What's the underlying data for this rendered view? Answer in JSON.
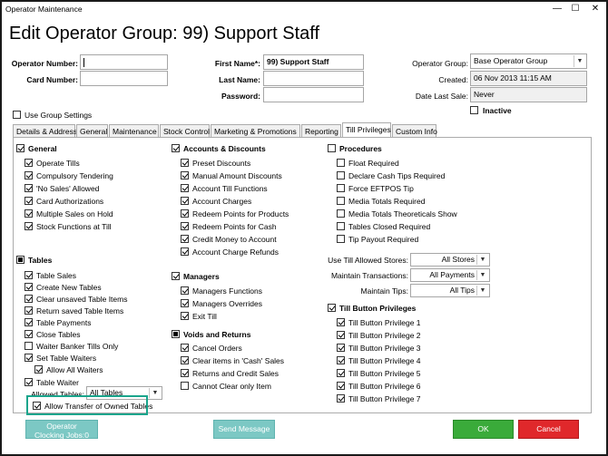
{
  "window": {
    "title": "Operator Maintenance",
    "minimize": "—",
    "maximize": "☐",
    "close": "✕"
  },
  "heading": "Edit Operator Group: 99) Support Staff",
  "form": {
    "operator_number_label": "Operator Number:",
    "operator_number_value": "",
    "card_number_label": "Card Number:",
    "card_number_value": "",
    "first_name_label": "First Name*:",
    "first_name_value": "99) Support Staff",
    "last_name_label": "Last Name:",
    "last_name_value": "",
    "password_label": "Password:",
    "password_value": "",
    "operator_group_label": "Operator Group:",
    "operator_group_value": "Base Operator Group",
    "created_label": "Created:",
    "created_value": "06 Nov 2013 11:15 AM",
    "date_last_sale_label": "Date Last Sale:",
    "date_last_sale_value": "Never",
    "inactive_label": "Inactive",
    "use_group_settings_label": "Use Group Settings"
  },
  "tabs": [
    {
      "label": "Details & Address"
    },
    {
      "label": "General"
    },
    {
      "label": "Maintenance"
    },
    {
      "label": "Stock Control"
    },
    {
      "label": "Marketing & Promotions"
    },
    {
      "label": "Reporting"
    },
    {
      "label": "Till Privileges"
    },
    {
      "label": "Custom Info"
    }
  ],
  "general": {
    "header": "General",
    "items": [
      "Operate Tills",
      "Compulsory Tendering",
      "'No Sales' Allowed",
      "Card Authorizations",
      "Multiple Sales on Hold",
      "Stock Functions at Till"
    ]
  },
  "tables": {
    "header": "Tables",
    "items": [
      "Table Sales",
      "Create New Tables",
      "Clear unsaved Table Items",
      "Return saved Table Items",
      "Table Payments",
      "Close Tables",
      "Waiter Banker Tills Only",
      "Set Table Waiters"
    ],
    "allow_all_waiters": "Allow All Waiters",
    "table_waiter": "Table Waiter",
    "allowed_tables_label": "Allowed Tables:",
    "allowed_tables_value": "All Tables",
    "allow_transfer": "Allow Transfer of Owned Tables"
  },
  "accounts": {
    "header": "Accounts & Discounts",
    "items": [
      "Preset Discounts",
      "Manual Amount Discounts",
      "Account Till Functions",
      "Account Charges",
      "Redeem Points for Products",
      "Redeem Points for Cash",
      "Credit Money to Account",
      "Account Charge Refunds"
    ]
  },
  "managers": {
    "header": "Managers",
    "items": [
      "Managers Functions",
      "Managers Overrides",
      "Exit Till"
    ]
  },
  "voids": {
    "header": "Voids and Returns",
    "items": [
      "Cancel Orders",
      "Clear items in 'Cash' Sales",
      "Returns and Credit Sales",
      "Cannot Clear only Item"
    ]
  },
  "procedures": {
    "header": "Procedures",
    "items": [
      "Float Required",
      "Declare Cash Tips Required",
      "Force EFTPOS Tip",
      "Media Totals Required",
      "Media Totals Theoreticals Show",
      "Tables Closed Required",
      "Tip Payout Required"
    ]
  },
  "selects": {
    "use_till_stores_label": "Use Till Allowed Stores:",
    "use_till_stores_value": "All Stores",
    "maintain_transactions_label": "Maintain Transactions:",
    "maintain_transactions_value": "All Payments",
    "maintain_tips_label": "Maintain Tips:",
    "maintain_tips_value": "All Tips"
  },
  "till_buttons": {
    "header": "Till Button Privileges",
    "items": [
      "Till Button Privilege 1",
      "Till Button Privilege 2",
      "Till Button Privilege 3",
      "Till Button Privilege 4",
      "Till Button Privilege 5",
      "Till Button Privilege 6",
      "Till Button Privilege 7"
    ]
  },
  "buttons": {
    "operator_clocking_line1": "Operator",
    "operator_clocking_line2": "Clocking Jobs:0",
    "send_message": "Send Message",
    "ok": "OK",
    "cancel": "Cancel"
  },
  "colors": {
    "highlight": "#1aa58c",
    "ok": "#3aab3a",
    "cancel": "#e0282b",
    "teal_button": "#7cc8c4"
  }
}
